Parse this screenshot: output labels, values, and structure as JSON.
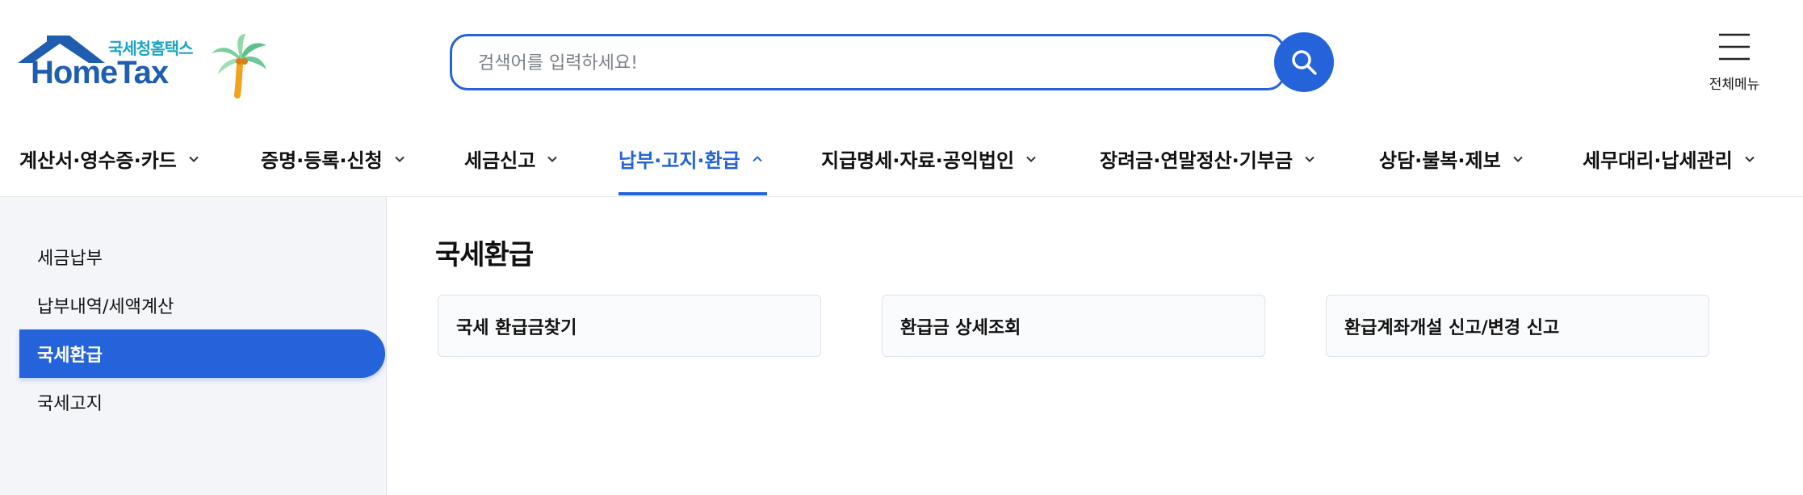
{
  "header": {
    "logo_sub": "국세청홈택스",
    "logo_main": "HomeTax",
    "search_placeholder": "검색어를 입력하세요!",
    "all_menu_label": "전체메뉴"
  },
  "gnb": {
    "items": [
      {
        "label": "계산서·영수증·카드",
        "active": false
      },
      {
        "label": "증명·등록·신청",
        "active": false
      },
      {
        "label": "세금신고",
        "active": false
      },
      {
        "label": "납부·고지·환급",
        "active": true
      },
      {
        "label": "지급명세·자료·공익법인",
        "active": false
      },
      {
        "label": "장려금·연말정산·기부금",
        "active": false
      },
      {
        "label": "상담·불복·제보",
        "active": false
      },
      {
        "label": "세무대리·납세관리",
        "active": false
      }
    ]
  },
  "sidebar": {
    "items": [
      {
        "label": "세금납부",
        "active": false
      },
      {
        "label": "납부내역/세액계산",
        "active": false
      },
      {
        "label": "국세환급",
        "active": true
      },
      {
        "label": "국세고지",
        "active": false
      }
    ]
  },
  "main": {
    "title": "국세환급",
    "cards": [
      {
        "label": "국세 환급금찾기"
      },
      {
        "label": "환급금 상세조회"
      },
      {
        "label": "환급계좌개설 신고/변경 신고"
      }
    ]
  },
  "colors": {
    "accent": "#2463d9",
    "logo_blue": "#1f5db0",
    "logo_teal": "#1ba4c7",
    "sidebar_bg": "#f3f5f9"
  }
}
